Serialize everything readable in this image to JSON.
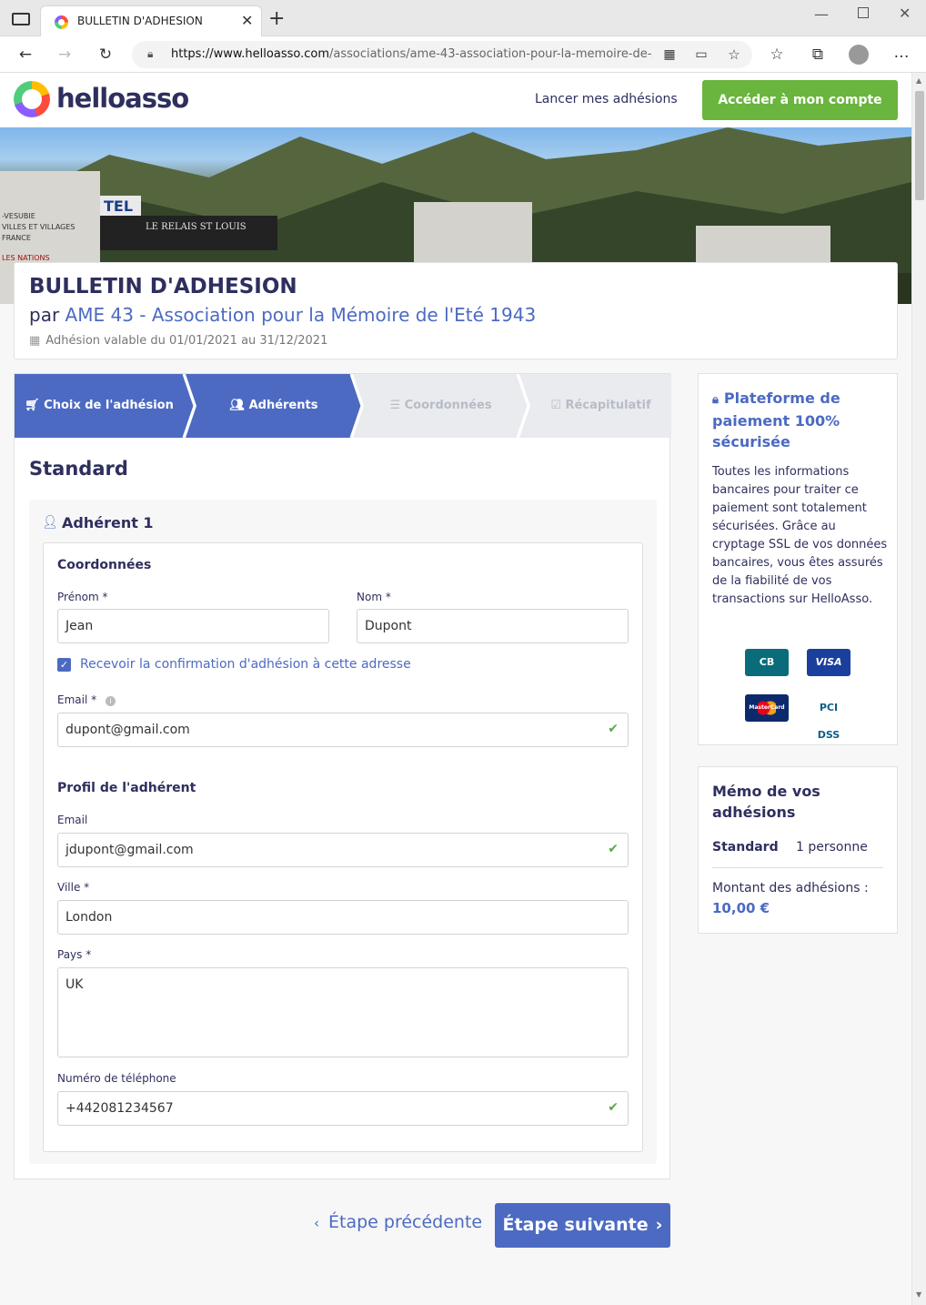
{
  "browser": {
    "tab_title": "BULLETIN D'ADHESION",
    "url_domain": "https://www.helloasso.com",
    "url_path": "/associations/ame-43-association-pour-la-memoire-de-..."
  },
  "header": {
    "logo_text": "helloasso",
    "nav_link": "Lancer mes adhésions",
    "account_button": "Accéder à mon compte"
  },
  "banner": {
    "sign_hotel": "TEL",
    "sign_relais": "LE RELAIS ST LOUIS",
    "plaque_lines": [
      "-VESUBIE",
      "VILLES ET VILLAGES",
      "FRANCE",
      "LES NATIONS"
    ]
  },
  "title_card": {
    "title": "BULLETIN D'ADHESION",
    "by": "par",
    "org_name": "AME 43 - Association pour la Mémoire de l'Eté 1943",
    "validity": "Adhésion valable du 01/01/2021 au 31/12/2021"
  },
  "steps": [
    {
      "label": "Choix de l'adhésion",
      "icon": "cart-icon",
      "state": "done"
    },
    {
      "label": "Adhérents",
      "icon": "users-icon",
      "state": "current"
    },
    {
      "label": "Coordonnées",
      "icon": "list-icon",
      "state": "todo"
    },
    {
      "label": "Récapitulatif",
      "icon": "check-square-icon",
      "state": "todo"
    }
  ],
  "form": {
    "section_title": "Standard",
    "member_title": "Adhérent 1",
    "coords_title": "Coordonnées",
    "first_name_label": "Prénom *",
    "first_name_value": "Jean",
    "last_name_label": "Nom *",
    "last_name_value": "Dupont",
    "confirm_label": "Recevoir la confirmation d'adhésion à cette adresse",
    "email_label": "Email *",
    "email_value": "dupont@gmail.com",
    "profile_title": "Profil de l'adhérent",
    "profile_email_label": "Email",
    "profile_email_value": "jdupont@gmail.com",
    "city_label": "Ville *",
    "city_value": "London",
    "country_label": "Pays *",
    "country_value": "UK",
    "phone_label": "Numéro de téléphone",
    "phone_value": "+442081234567"
  },
  "buttons": {
    "previous": "Étape précédente",
    "next": "Étape suivante"
  },
  "security": {
    "title": "Plateforme de paiement 100% sécurisée",
    "text": "Toutes les informations bancaires pour traiter ce paiement sont totalement sécurisées. Grâce au cryptage SSL de vos données bancaires, vous êtes assurés de la fiabilité de vos transactions sur HelloAsso.",
    "cards": [
      "CB",
      "VISA",
      "MasterCard",
      "PCI DSS"
    ]
  },
  "memo": {
    "title": "Mémo de vos adhésions",
    "item": "Standard",
    "qty": "1 personne",
    "total_label": "Montant des adhésions :",
    "total_value": "10,00 €"
  },
  "colors": {
    "primary": "#4c6ac2",
    "account_button": "#69b53e",
    "text_dark": "#2e2f5e",
    "valid": "#5aa848"
  }
}
